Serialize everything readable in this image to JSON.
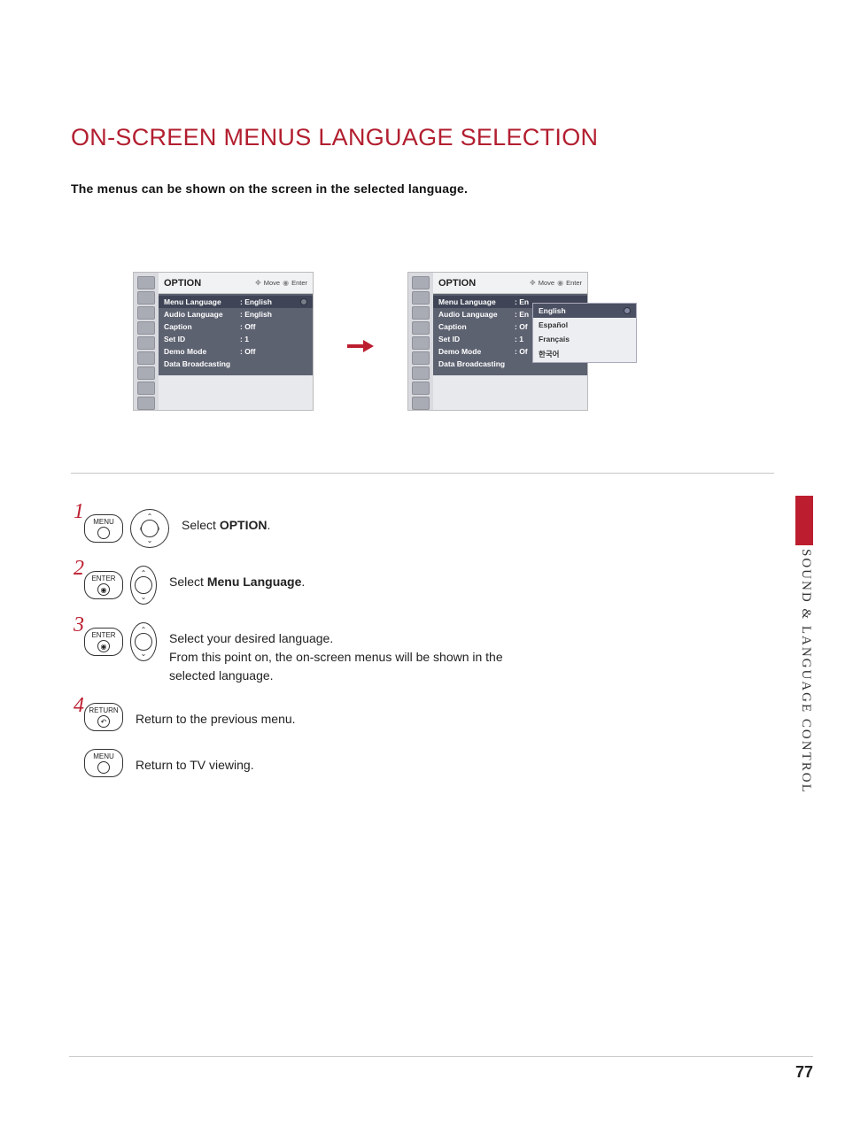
{
  "title": "ON-SCREEN MENUS LANGUAGE SELECTION",
  "intro": "The menus can be shown on the screen in the selected language.",
  "section_label": "SOUND & LANGUAGE CONTROL",
  "page_number": "77",
  "osd": {
    "header_title": "OPTION",
    "header_move": "Move",
    "header_enter": "Enter",
    "rows": [
      {
        "label": "Menu Language",
        "value": ": English"
      },
      {
        "label": "Audio Language",
        "value": ": English"
      },
      {
        "label": "Caption",
        "value": ": Off"
      },
      {
        "label": "Set ID",
        "value": ": 1"
      },
      {
        "label": "Demo Mode",
        "value": ": Off"
      },
      {
        "label": "Data Broadcasting",
        "value": ""
      }
    ],
    "rows2": [
      {
        "label": "Menu Language",
        "value": ": En"
      },
      {
        "label": "Audio Language",
        "value": ": En"
      },
      {
        "label": "Caption",
        "value": ": Of"
      },
      {
        "label": "Set ID",
        "value": ": 1"
      },
      {
        "label": "Demo Mode",
        "value": ": Of"
      },
      {
        "label": "Data Broadcasting",
        "value": ""
      }
    ],
    "popup": [
      "English",
      "Español",
      "Français",
      "한국어"
    ]
  },
  "steps": {
    "s1_select": "Select ",
    "s1_bold": "OPTION",
    "s1_end": ".",
    "s2_select": "Select ",
    "s2_bold": "Menu Language",
    "s2_end": ".",
    "s3_line1": "Select your desired language.",
    "s3_line2": "From this point on, the on-screen menus will be shown in the selected language.",
    "s4": "Return to the previous menu.",
    "s5": "Return to TV viewing."
  },
  "buttons": {
    "menu": "MENU",
    "enter": "ENTER",
    "return": "RETURN"
  }
}
